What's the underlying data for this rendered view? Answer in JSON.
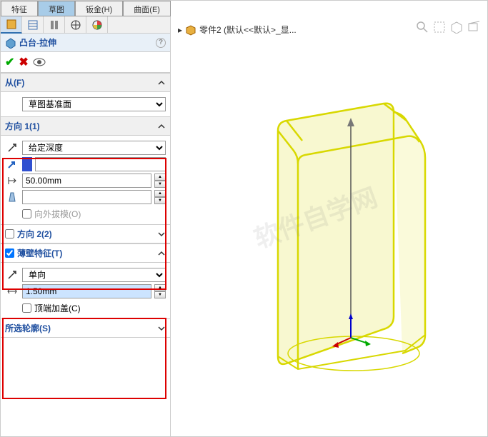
{
  "tabs": {
    "t0": "特征",
    "t1": "草图",
    "t2": "钣金(H)",
    "t3": "曲面(E)"
  },
  "feature": {
    "title": "凸台-拉伸"
  },
  "from": {
    "label": "从(F)",
    "option": "草图基准面"
  },
  "dir1": {
    "label": "方向 1(1)",
    "endcond": "给定深度",
    "blank": "",
    "depth": "50.00mm",
    "blank2": "",
    "draft_chk": "向外拔模(O)"
  },
  "dir2": {
    "label": "方向 2(2)"
  },
  "thin": {
    "label": "薄壁特征(T)",
    "type": "单向",
    "thickness": "1.50mm",
    "cap_chk": "顶端加盖(C)"
  },
  "contours": {
    "label": "所选轮廓(S)"
  },
  "breadcrumb": {
    "part": "零件2 (默认<<默认>_显..."
  }
}
